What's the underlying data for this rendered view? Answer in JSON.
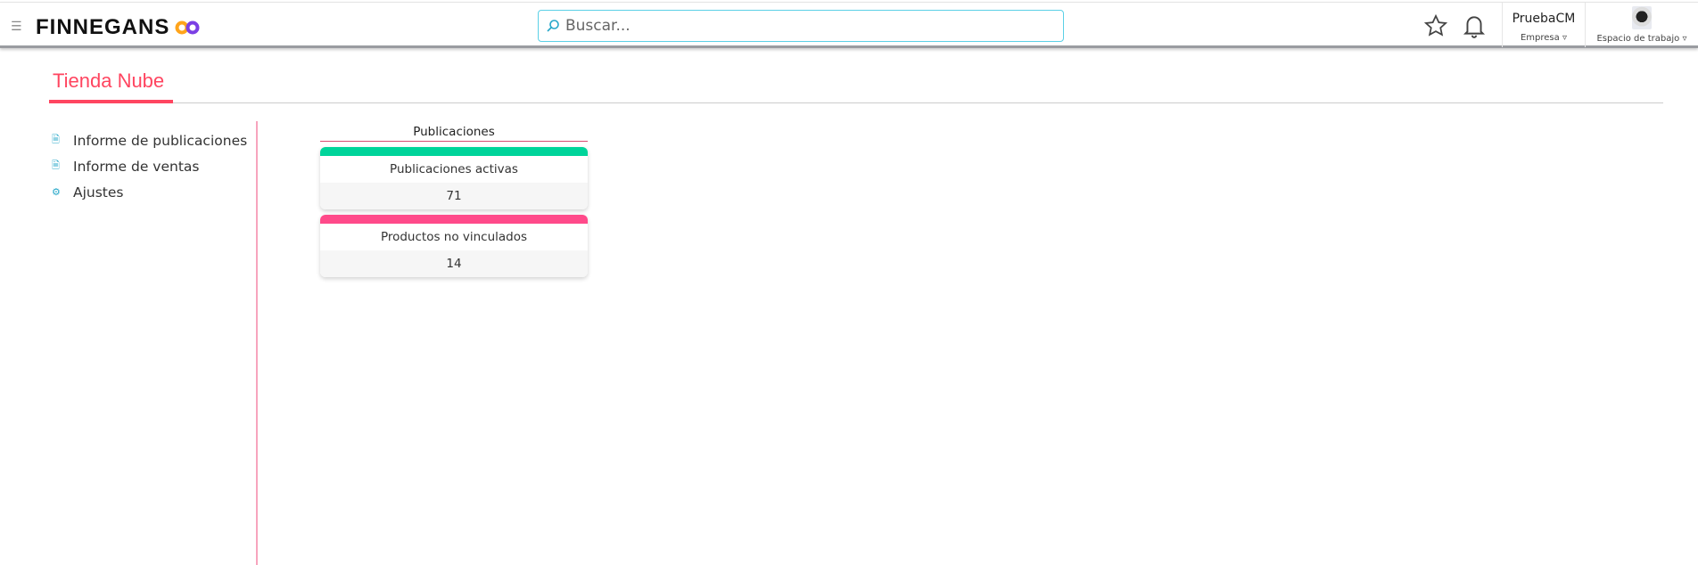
{
  "header": {
    "logo": "FINNEGANS",
    "search_placeholder": "Buscar...",
    "company_name": "PruebaCM",
    "company_label": "Empresa",
    "workspace_label": "Espacio de trabajo"
  },
  "page": {
    "title": "Tienda Nube"
  },
  "sidebar": {
    "items": [
      {
        "label": "Informe de publicaciones",
        "icon": "report-icon"
      },
      {
        "label": "Informe de ventas",
        "icon": "report-icon"
      },
      {
        "label": "Ajustes",
        "icon": "gear-icon"
      }
    ]
  },
  "main": {
    "section_title": "Publicaciones",
    "cards": [
      {
        "label": "Publicaciones activas",
        "value": "71",
        "color": "#00d49a"
      },
      {
        "label": "Productos no vinculados",
        "value": "14",
        "color": "#ff4a8a"
      }
    ]
  },
  "colors": {
    "accent": "#ff4560",
    "search_border": "#5bd0e6"
  }
}
